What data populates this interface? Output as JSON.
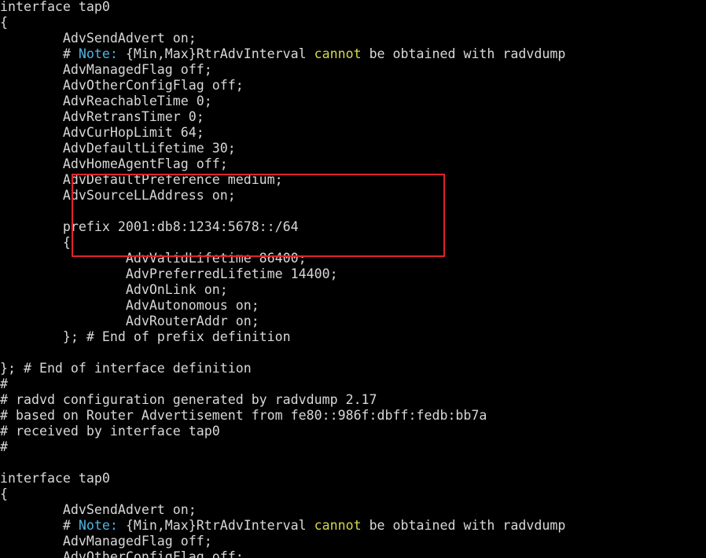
{
  "colors": {
    "background": "#000000",
    "text": "#d8d8d8",
    "note_keyword": "#4fb3e0",
    "cannot_keyword": "#d6d64a",
    "highlight_box": "#e0242a"
  },
  "lines": [
    [
      {
        "t": "interface tap0"
      }
    ],
    [
      {
        "t": "{"
      }
    ],
    [
      {
        "t": "        AdvSendAdvert on;"
      }
    ],
    [
      {
        "t": "        # "
      },
      {
        "t": "Note:",
        "c": "note"
      },
      {
        "t": " {Min,Max}RtrAdvInterval "
      },
      {
        "t": "cannot",
        "c": "cannot"
      },
      {
        "t": " be obtained with radvdump"
      }
    ],
    [
      {
        "t": "        AdvManagedFlag off;"
      }
    ],
    [
      {
        "t": "        AdvOtherConfigFlag off;"
      }
    ],
    [
      {
        "t": "        AdvReachableTime 0;"
      }
    ],
    [
      {
        "t": "        AdvRetransTimer 0;"
      }
    ],
    [
      {
        "t": "        AdvCurHopLimit 64;"
      }
    ],
    [
      {
        "t": "        AdvDefaultLifetime 30;"
      }
    ],
    [
      {
        "t": "        AdvHomeAgentFlag off;"
      }
    ],
    [
      {
        "t": "        AdvDefaultPreference medium;"
      }
    ],
    [
      {
        "t": "        AdvSourceLLAddress on;"
      }
    ],
    [
      {
        "t": ""
      }
    ],
    [
      {
        "t": "        prefix 2001:db8:1234:5678::/64"
      }
    ],
    [
      {
        "t": "        {"
      }
    ],
    [
      {
        "t": "                AdvValidLifetime 86400;"
      }
    ],
    [
      {
        "t": "                AdvPreferredLifetime 14400;"
      }
    ],
    [
      {
        "t": "                AdvOnLink on;"
      }
    ],
    [
      {
        "t": "                AdvAutonomous on;"
      }
    ],
    [
      {
        "t": "                AdvRouterAddr on;"
      }
    ],
    [
      {
        "t": "        }; # End of prefix definition"
      }
    ],
    [
      {
        "t": ""
      }
    ],
    [
      {
        "t": "}; # End of interface definition"
      }
    ],
    [
      {
        "t": "#"
      }
    ],
    [
      {
        "t": "# radvd configuration generated by radvdump 2.17"
      }
    ],
    [
      {
        "t": "# based on Router Advertisement from fe80::986f:dbff:fedb:bb7a"
      }
    ],
    [
      {
        "t": "# received by interface tap0"
      }
    ],
    [
      {
        "t": "#"
      }
    ],
    [
      {
        "t": ""
      }
    ],
    [
      {
        "t": "interface tap0"
      }
    ],
    [
      {
        "t": "{"
      }
    ],
    [
      {
        "t": "        AdvSendAdvert on;"
      }
    ],
    [
      {
        "t": "        # "
      },
      {
        "t": "Note:",
        "c": "note"
      },
      {
        "t": " {Min,Max}RtrAdvInterval "
      },
      {
        "t": "cannot",
        "c": "cannot"
      },
      {
        "t": " be obtained with radvdump"
      }
    ],
    [
      {
        "t": "        AdvManagedFlag off;"
      }
    ],
    [
      {
        "t": "        AdvOtherConfigFlag off;"
      }
    ]
  ]
}
